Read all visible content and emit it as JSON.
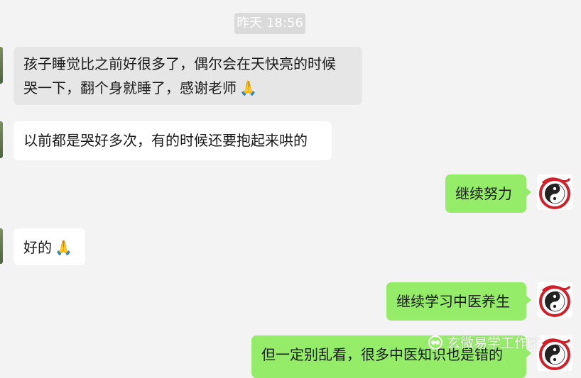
{
  "timestamp": "昨天 18:56",
  "messages": [
    {
      "direction": "in",
      "lines": [
        "孩子睡觉比之前好很多了，偶尔会在天快亮的时候",
        "哭一下，翻个身就睡了，感谢老师"
      ],
      "emoji": "🙏"
    },
    {
      "direction": "in",
      "text": "以前都是哭好多次，有的时候还要抱起来哄的"
    },
    {
      "direction": "out",
      "text": "继续努力"
    },
    {
      "direction": "in",
      "text": "好的",
      "emoji": "🙏"
    },
    {
      "direction": "out",
      "text": "继续学习中医养生"
    },
    {
      "direction": "out",
      "text": "但一定别乱看，很多中医知识也是错的"
    }
  ],
  "watermark": "玄微易学工作室",
  "colors": {
    "background": "#f3f3f3",
    "incoming_bubble_gray": "#e6e6e6",
    "incoming_bubble_white": "#ffffff",
    "outgoing_bubble": "#95ec69",
    "timestamp_bg": "#dadada"
  },
  "avatar_icon": "taiji-dragon-icon"
}
